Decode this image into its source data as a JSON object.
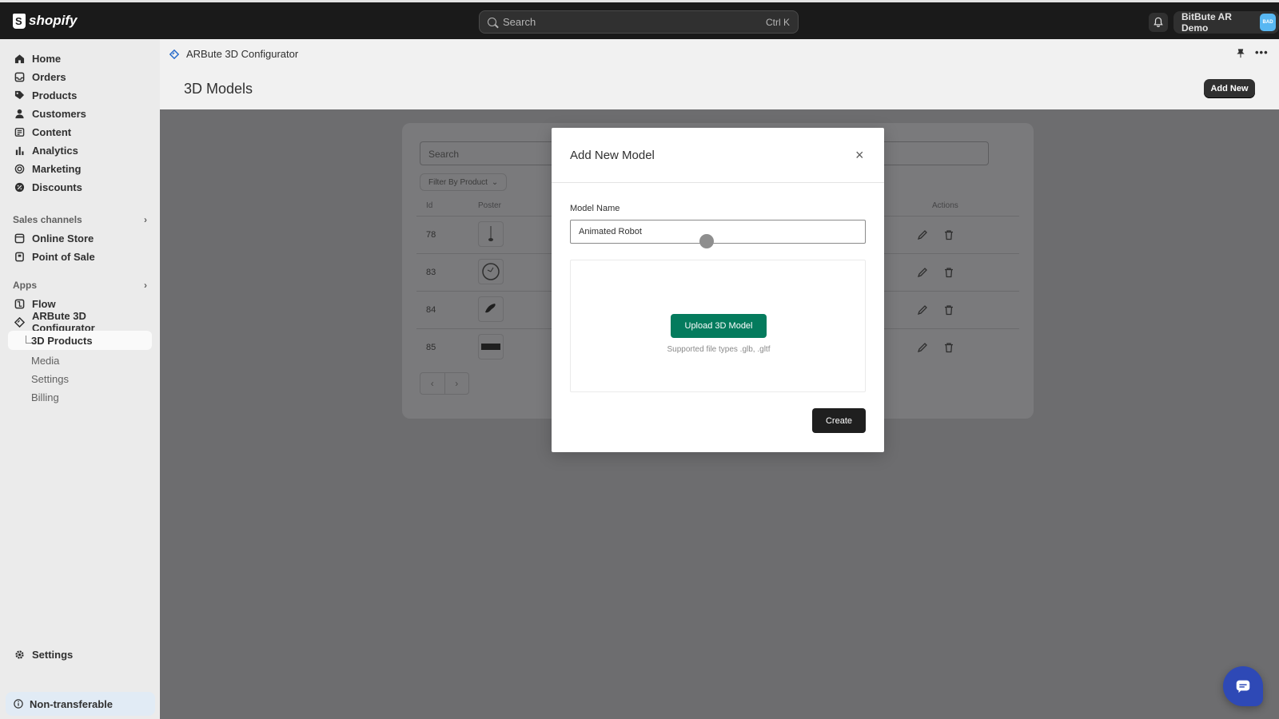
{
  "topbar": {
    "logo_text": "shopify",
    "search_placeholder": "Search",
    "search_shortcut": "Ctrl K",
    "store_name": "BitBute AR Demo",
    "store_initials": "BAD"
  },
  "sidebar": {
    "items": [
      {
        "label": "Home",
        "icon": "home-icon"
      },
      {
        "label": "Orders",
        "icon": "orders-icon"
      },
      {
        "label": "Products",
        "icon": "tag-icon"
      },
      {
        "label": "Customers",
        "icon": "person-icon"
      },
      {
        "label": "Content",
        "icon": "content-icon"
      },
      {
        "label": "Analytics",
        "icon": "bar-chart-icon"
      },
      {
        "label": "Marketing",
        "icon": "target-icon"
      },
      {
        "label": "Discounts",
        "icon": "discount-icon"
      }
    ],
    "sales_channels_title": "Sales channels",
    "sales_channels": [
      {
        "label": "Online Store",
        "icon": "store-icon"
      },
      {
        "label": "Point of Sale",
        "icon": "pos-icon"
      }
    ],
    "apps_title": "Apps",
    "apps": [
      {
        "label": "Flow",
        "icon": "flow-icon"
      },
      {
        "label": "ARBute 3D Configurator",
        "icon": "diamond-icon"
      }
    ],
    "app_sub": {
      "active": "3D Products",
      "others": [
        "Media",
        "Settings",
        "Billing"
      ]
    },
    "settings_label": "Settings",
    "non_transferable": "Non-transferable"
  },
  "main": {
    "app_name": "ARBute 3D Configurator",
    "page_title": "3D Models",
    "add_new_label": "Add New"
  },
  "background_table": {
    "search_placeholder": "Search",
    "filter_label": "Filter By Product",
    "headers": {
      "id": "Id",
      "poster": "Poster",
      "actions": "Actions"
    },
    "rows": [
      {
        "id": "78"
      },
      {
        "id": "83"
      },
      {
        "id": "84"
      },
      {
        "id": "85"
      }
    ],
    "pager_prev": "‹",
    "pager_next": "›"
  },
  "modal": {
    "title": "Add New Model",
    "close": "×",
    "field_label": "Model Name",
    "field_value": "Animated Robot",
    "upload_label": "Upload 3D Model",
    "supported_text": "Supported file types .glb, .gltf",
    "create_label": "Create"
  },
  "colors": {
    "upload_green": "#047b5d",
    "topbar": "#1a1a1a",
    "chat_blue": "#2e49b6",
    "avatar_blue": "#58b7f2"
  }
}
